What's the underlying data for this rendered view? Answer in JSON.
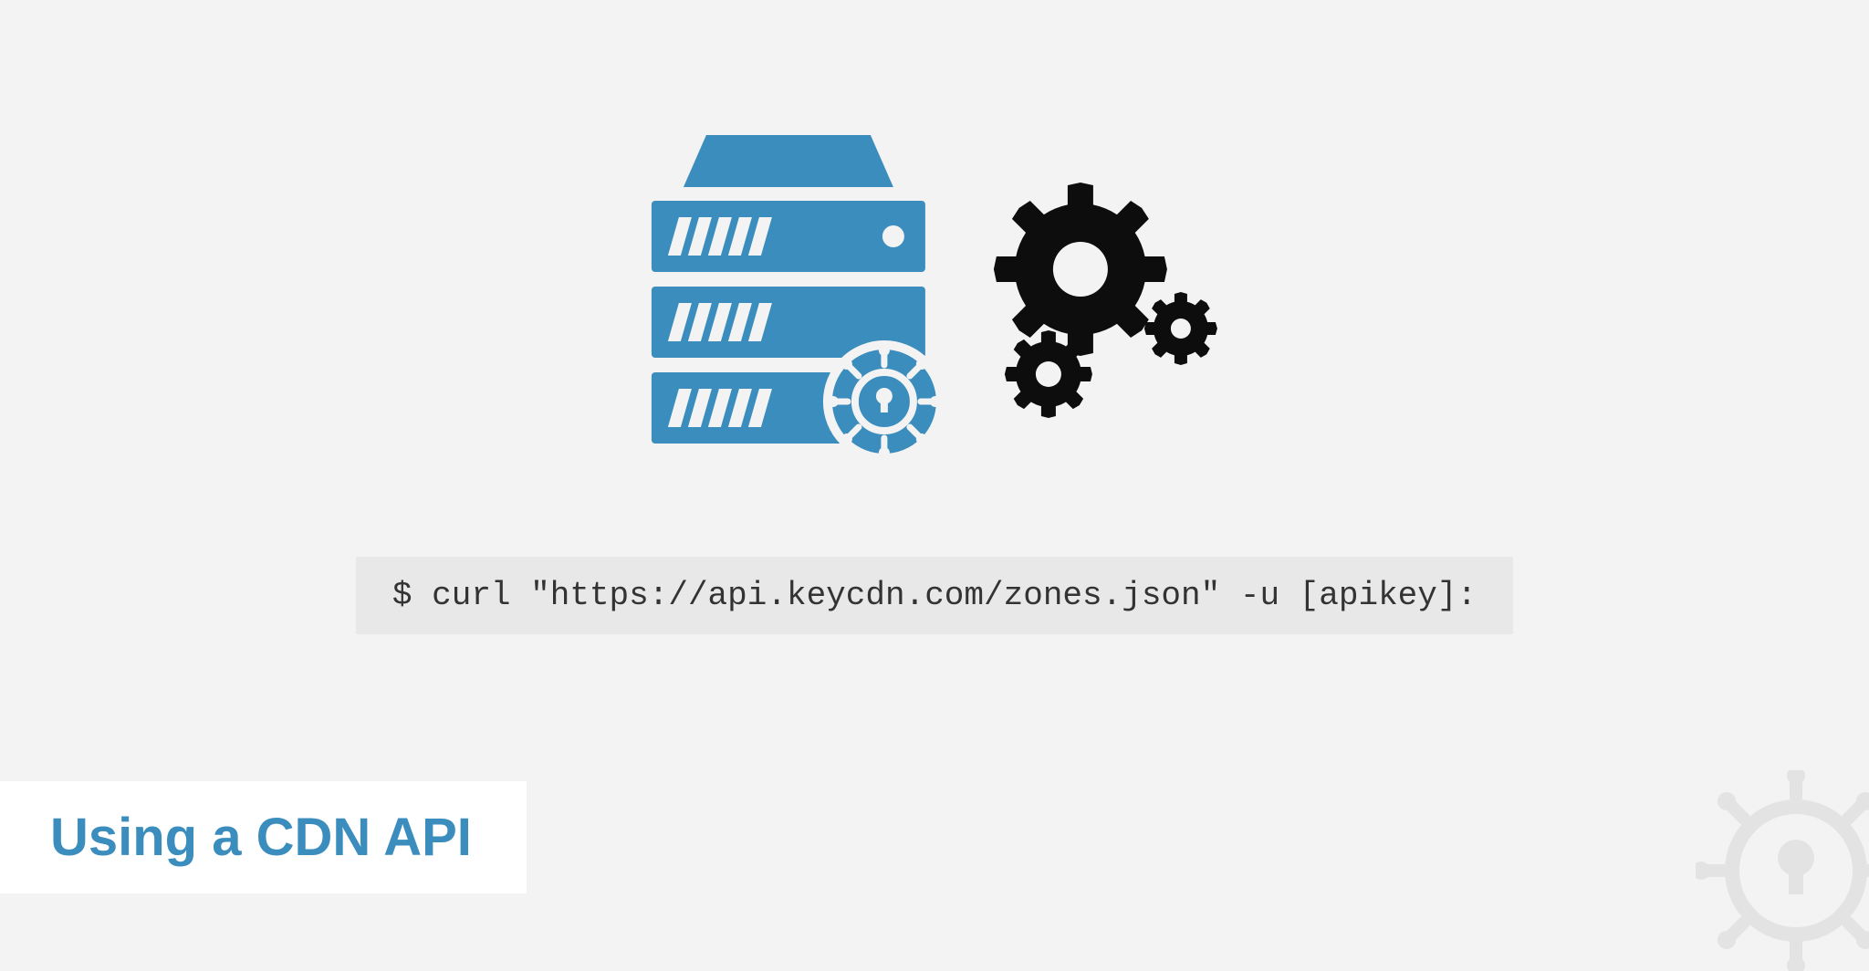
{
  "title": "Using a CDN API",
  "code_command": "$ curl \"https://api.keycdn.com/zones.json\" -u [apikey]:",
  "colors": {
    "accent": "#3a8dbd",
    "background": "#f3f3f3",
    "code_bg": "#e8e8e8"
  },
  "icons": {
    "server": "server-with-badge-icon",
    "gears": "gears-icon",
    "watermark": "keycdn-logo-icon"
  }
}
